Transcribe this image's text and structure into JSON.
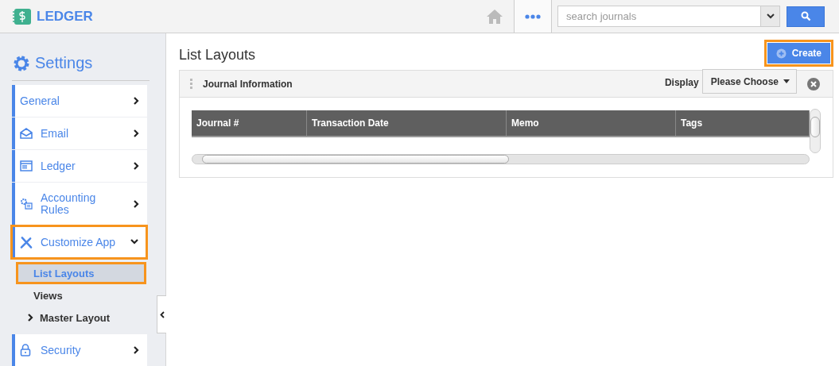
{
  "app": {
    "name": "LEDGER"
  },
  "topbar": {
    "search": {
      "placeholder": "search journals"
    }
  },
  "sidebar": {
    "title": "Settings",
    "items": [
      {
        "label": "General",
        "expanded": false,
        "highlighted": false
      },
      {
        "label": "Email",
        "expanded": false,
        "highlighted": false
      },
      {
        "label": "Ledger",
        "expanded": false,
        "highlighted": false
      },
      {
        "label": "Accounting Rules",
        "expanded": false,
        "highlighted": false
      },
      {
        "label": "Customize App",
        "expanded": true,
        "highlighted": true,
        "children": [
          {
            "label": "List Layouts",
            "selected": true,
            "highlighted": true,
            "has_children": false
          },
          {
            "label": "Views",
            "selected": false,
            "highlighted": false,
            "has_children": false
          },
          {
            "label": "Master Layout",
            "selected": false,
            "highlighted": false,
            "has_children": true
          }
        ]
      },
      {
        "label": "Security",
        "expanded": false,
        "highlighted": false
      }
    ]
  },
  "content": {
    "title": "List Layouts",
    "create_button": {
      "label": "Create",
      "highlighted": true
    },
    "panel": {
      "title": "Journal Information",
      "display_label": "Display",
      "display_select": "Please Choose",
      "columns": [
        "Journal #",
        "Transaction Date",
        "Memo",
        "Tags"
      ]
    }
  }
}
